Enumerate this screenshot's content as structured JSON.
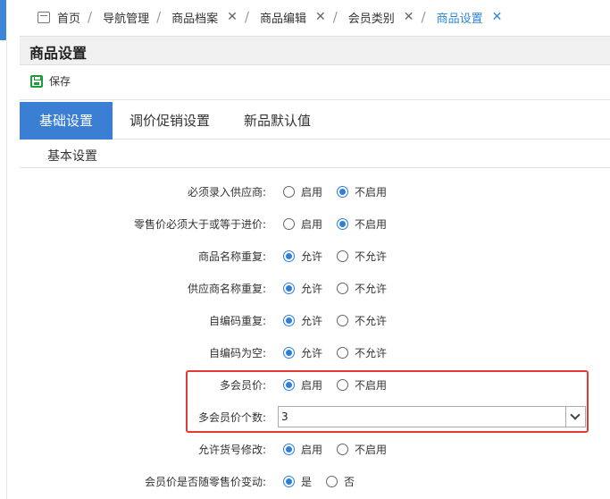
{
  "breadcrumb": [
    {
      "label": "首页",
      "closable": false,
      "active": false
    },
    {
      "label": "导航管理",
      "closable": false,
      "active": false
    },
    {
      "label": "商品档案",
      "closable": true,
      "active": false
    },
    {
      "label": "商品编辑",
      "closable": true,
      "active": false
    },
    {
      "label": "会员类别",
      "closable": true,
      "active": false
    },
    {
      "label": "商品设置",
      "closable": true,
      "active": true
    }
  ],
  "page_title": "商品设置",
  "toolbar": {
    "save_label": "保存"
  },
  "tabs": [
    {
      "label": "基础设置",
      "active": true
    },
    {
      "label": "调价促销设置",
      "active": false
    },
    {
      "label": "新品默认值",
      "active": false
    }
  ],
  "section_title": "基本设置",
  "settings": [
    {
      "label": "必须录入供应商:",
      "options": [
        "启用",
        "不启用"
      ],
      "selected": 1
    },
    {
      "label": "零售价必须大于或等于进价:",
      "options": [
        "启用",
        "不启用"
      ],
      "selected": 1
    },
    {
      "label": "商品名称重复:",
      "options": [
        "允许",
        "不允许"
      ],
      "selected": 0
    },
    {
      "label": "供应商名称重复:",
      "options": [
        "允许",
        "不允许"
      ],
      "selected": 0
    },
    {
      "label": "自编码重复:",
      "options": [
        "允许",
        "不允许"
      ],
      "selected": 0
    },
    {
      "label": "自编码为空:",
      "options": [
        "允许",
        "不允许"
      ],
      "selected": 0
    },
    {
      "label": "多会员价:",
      "options": [
        "启用",
        "不启用"
      ],
      "selected": 0
    }
  ],
  "member_price_count": {
    "label": "多会员价个数:",
    "value": "3"
  },
  "settings_after": [
    {
      "label": "允许货号修改:",
      "options": [
        "启用",
        "不启用"
      ],
      "selected": 0
    },
    {
      "label": "会员价是否随零售价变动:",
      "options": [
        "是",
        "否"
      ],
      "selected": 0
    }
  ],
  "colors": {
    "accent": "#3b7fd4",
    "save_icon": "#1c9c3a",
    "highlight": "#e53935",
    "active_crumb": "#2f86d6"
  }
}
